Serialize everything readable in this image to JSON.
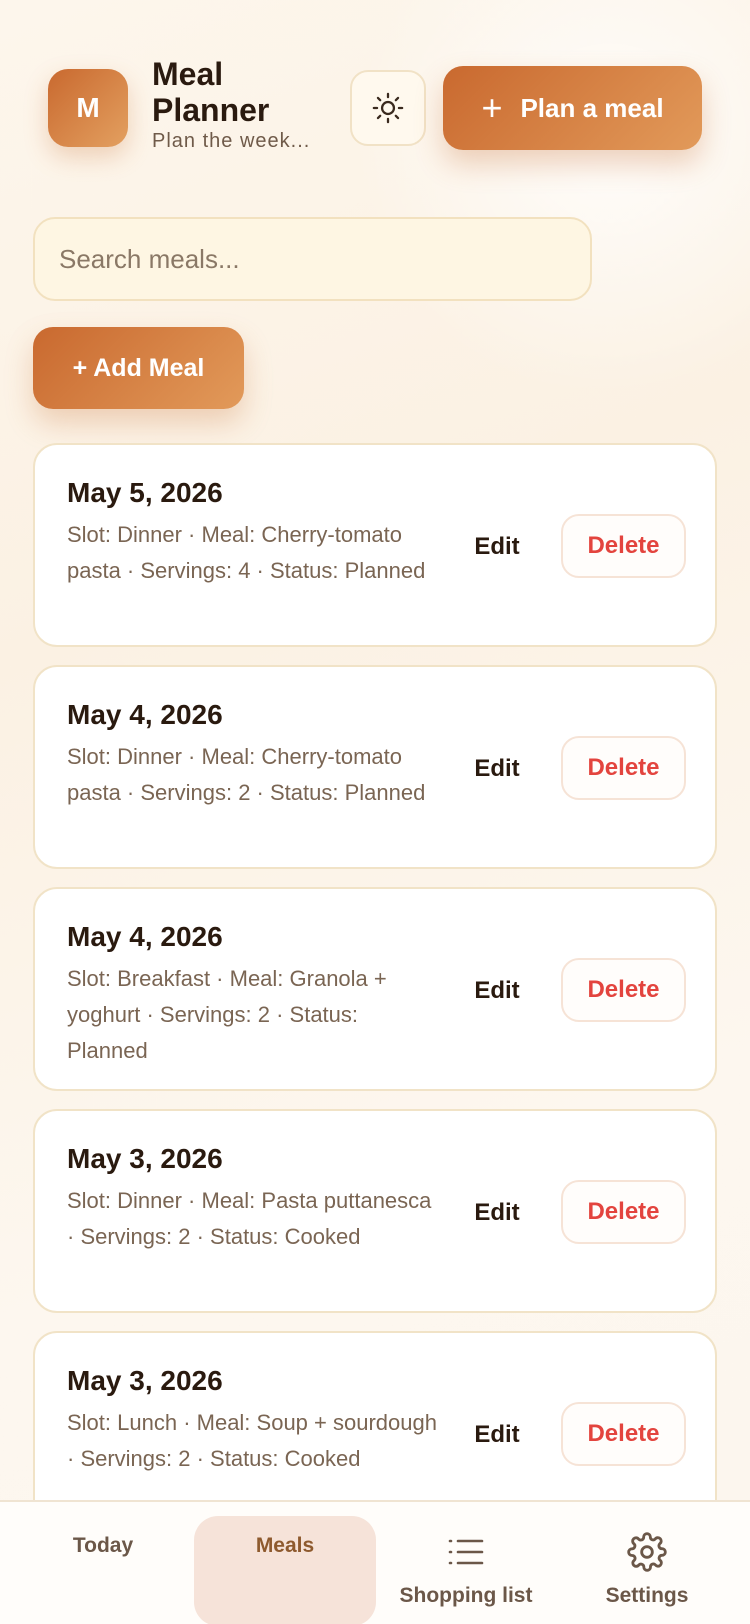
{
  "header": {
    "avatar_letter": "M",
    "title": "Meal Planner",
    "subtitle": "Plan the week...",
    "theme_icon": "sun-icon",
    "plan_button_label": "Plan a meal"
  },
  "search": {
    "placeholder": "Search meals..."
  },
  "add_button_label": "+ Add Meal",
  "meals": [
    {
      "date": "May 5, 2026",
      "details": "Slot: Dinner · Meal: Cherry-tomato pasta · Servings: 4 · Status: Planned",
      "edit": "Edit",
      "delete": "Delete"
    },
    {
      "date": "May 4, 2026",
      "details": "Slot: Dinner · Meal: Cherry-tomato pasta · Servings: 2 · Status: Planned",
      "edit": "Edit",
      "delete": "Delete"
    },
    {
      "date": "May 4, 2026",
      "details": "Slot: Breakfast · Meal: Granola + yoghurt · Servings: 2 · Status: Planned",
      "edit": "Edit",
      "delete": "Delete"
    },
    {
      "date": "May 3, 2026",
      "details": "Slot: Dinner · Meal: Pasta puttanesca · Servings: 2 · Status: Cooked",
      "edit": "Edit",
      "delete": "Delete"
    },
    {
      "date": "May 3, 2026",
      "details": "Slot: Lunch · Meal: Soup + sourdough · Servings: 2 · Status: Cooked",
      "edit": "Edit",
      "delete": "Delete"
    }
  ],
  "nav": [
    {
      "label": "Today",
      "active": false
    },
    {
      "label": "Meals",
      "active": true
    },
    {
      "label": "Shopping list",
      "icon": "list-icon",
      "active": false
    },
    {
      "label": "Settings",
      "icon": "gear-icon",
      "active": false
    }
  ],
  "colors": {
    "accent": "#d07a3c",
    "delete": "#e3443e",
    "card_border": "#f1e3c7",
    "nav_active_bg": "#f6e3d9"
  }
}
